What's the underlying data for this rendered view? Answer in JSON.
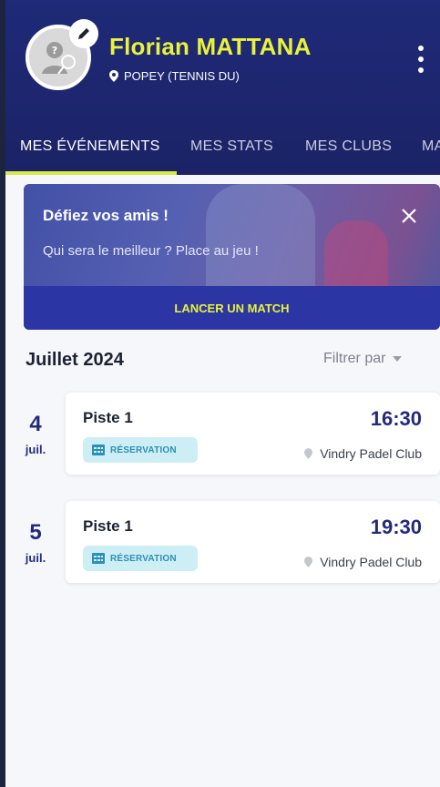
{
  "profile": {
    "name": "Florian MATTANA",
    "location": "POPEY (TENNIS DU)"
  },
  "tabs": [
    {
      "label": "MES ÉVÉNEMENTS",
      "active": true
    },
    {
      "label": "MES STATS",
      "active": false
    },
    {
      "label": "MES CLUBS",
      "active": false
    },
    {
      "label": "MA",
      "active": false
    }
  ],
  "promo": {
    "title": "Défiez vos amis !",
    "text": "Qui sera le meilleur ? Place au jeu !",
    "cta": "LANCER UN MATCH"
  },
  "events_header": {
    "month": "Juillet 2024",
    "filter_label": "Filtrer par"
  },
  "events": [
    {
      "day": "4",
      "month": "juil.",
      "court": "Piste 1",
      "time": "16:30",
      "badge": "RÉSERVATION",
      "club": "Vindry Padel Club"
    },
    {
      "day": "5",
      "month": "juil.",
      "court": "Piste 1",
      "time": "19:30",
      "badge": "RÉSERVATION",
      "club": "Vindry Padel Club"
    }
  ],
  "colors": {
    "header_bg": "#1f2a78",
    "accent_yellow": "#e8f33a",
    "primary_blue": "#232a7e",
    "badge_bg": "#cdeef5",
    "badge_text": "#2c8fb6"
  },
  "icons": {
    "edit": "pencil-icon",
    "location": "map-pin-icon",
    "menu": "kebab-menu-icon",
    "close": "close-icon",
    "filter": "chevron-down-icon",
    "badge": "calendar-grid-icon",
    "club": "map-pin-icon"
  }
}
